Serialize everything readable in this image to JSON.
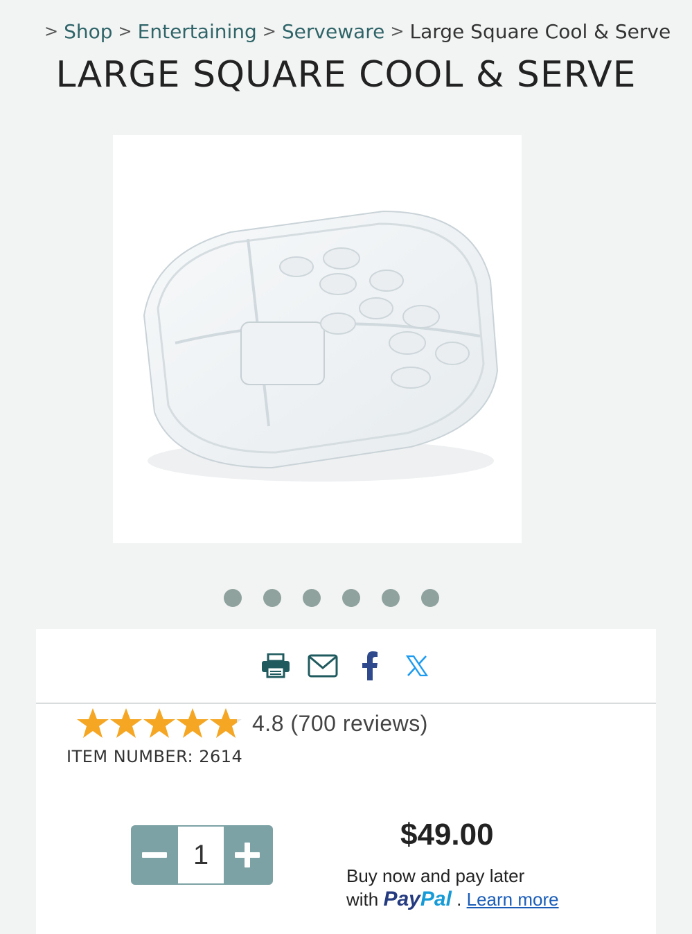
{
  "breadcrumb": {
    "home_icon": "home-icon",
    "separator": ">",
    "items": [
      {
        "label": "Shop"
      },
      {
        "label": "Entertaining"
      },
      {
        "label": "Serveware"
      }
    ],
    "current": "Large Square Cool & Serve"
  },
  "product": {
    "title": "LARGE SQUARE COOL & SERVE",
    "image_alt_icon": "product-photo-clear-square-container",
    "carousel_dot_count": 6,
    "rating_value": "4.8",
    "rating_text": "4.8 (700 reviews)",
    "stars": 4.8,
    "item_number": "ITEM NUMBER: 2614",
    "quantity": "1",
    "price": "$49.00",
    "paylater_line1": "Buy now and pay later",
    "paylater_with": "with",
    "paypal_part1": "Pay",
    "paypal_part2": "Pal",
    "paylater_dot": ".",
    "learn_more": "Learn more"
  },
  "share": {
    "icons": [
      "print-icon",
      "email-icon",
      "facebook-icon",
      "x-icon"
    ]
  },
  "colors": {
    "accent": "#2f6468",
    "stepper": "#7da2a6",
    "star": "#f5a623",
    "dot": "#8fa29d"
  }
}
